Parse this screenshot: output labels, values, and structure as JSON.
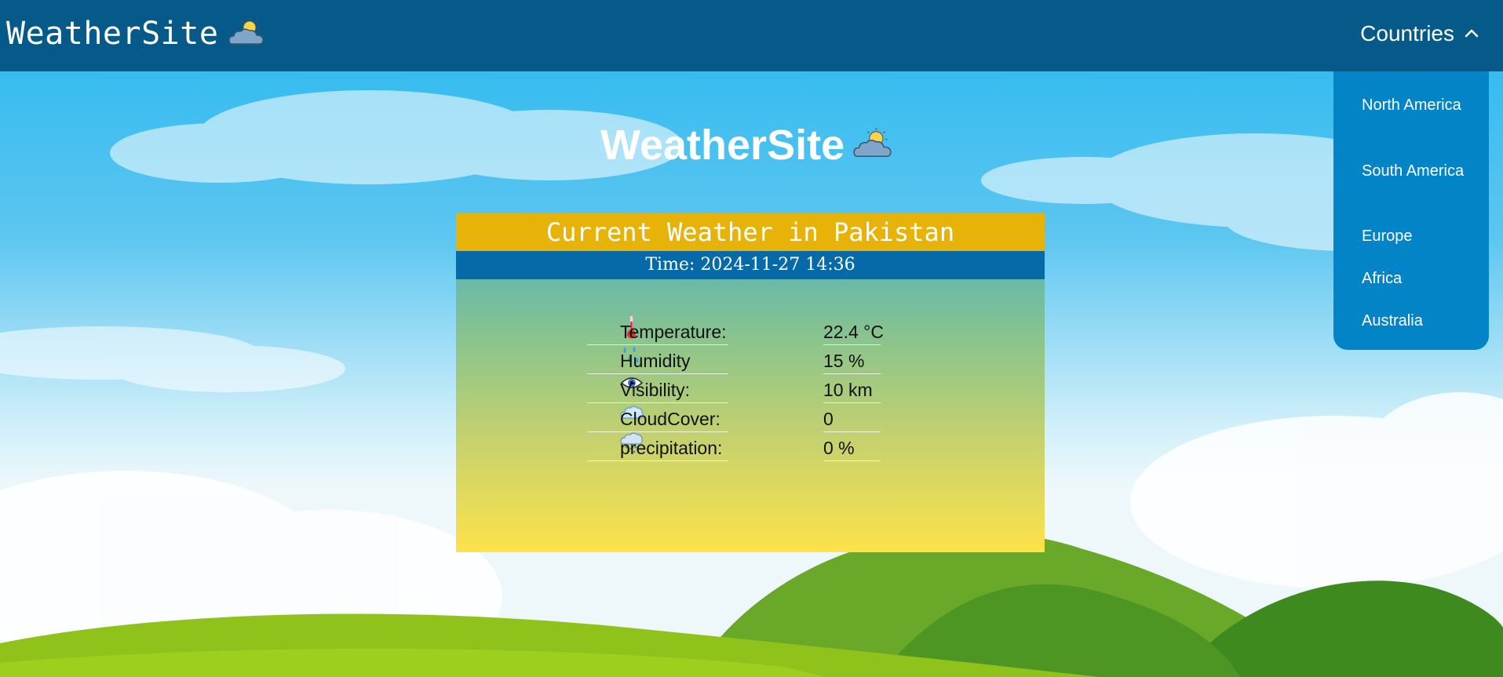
{
  "nav": {
    "brand": "WeatherSite",
    "brand_icon": "partly-cloudy-icon",
    "countries_label": "Countries",
    "countries_icon": "chevron-up-icon",
    "menu": [
      {
        "label": "North America"
      },
      {
        "label": "South America"
      },
      {
        "label": "Europe"
      },
      {
        "label": "Africa"
      },
      {
        "label": "Australia"
      }
    ]
  },
  "hero": {
    "title": "WeatherSite",
    "icon": "partly-cloudy-icon"
  },
  "card": {
    "title": "Current Weather in Pakistan",
    "time": "Time: 2024-11-27 14:36",
    "rows": [
      {
        "icon": "thermometer-icon",
        "label": "Temperature:",
        "value": "22.4 °C"
      },
      {
        "icon": "humidity-drops-icon",
        "label": "Humidity",
        "value": "15 %"
      },
      {
        "icon": "eye-icon",
        "label": "Visibility:",
        "value": "10 km"
      },
      {
        "icon": "cloud-icon",
        "label": "CloudCover:",
        "value": "0"
      },
      {
        "icon": "rain-cloud-icon",
        "label": "precipitation:",
        "value": "0 %"
      }
    ]
  },
  "colors": {
    "navbar": "#065a8a",
    "dropdown": "#0284c7",
    "card_header": "#e7b308",
    "card_time_bar": "#066aa8"
  }
}
